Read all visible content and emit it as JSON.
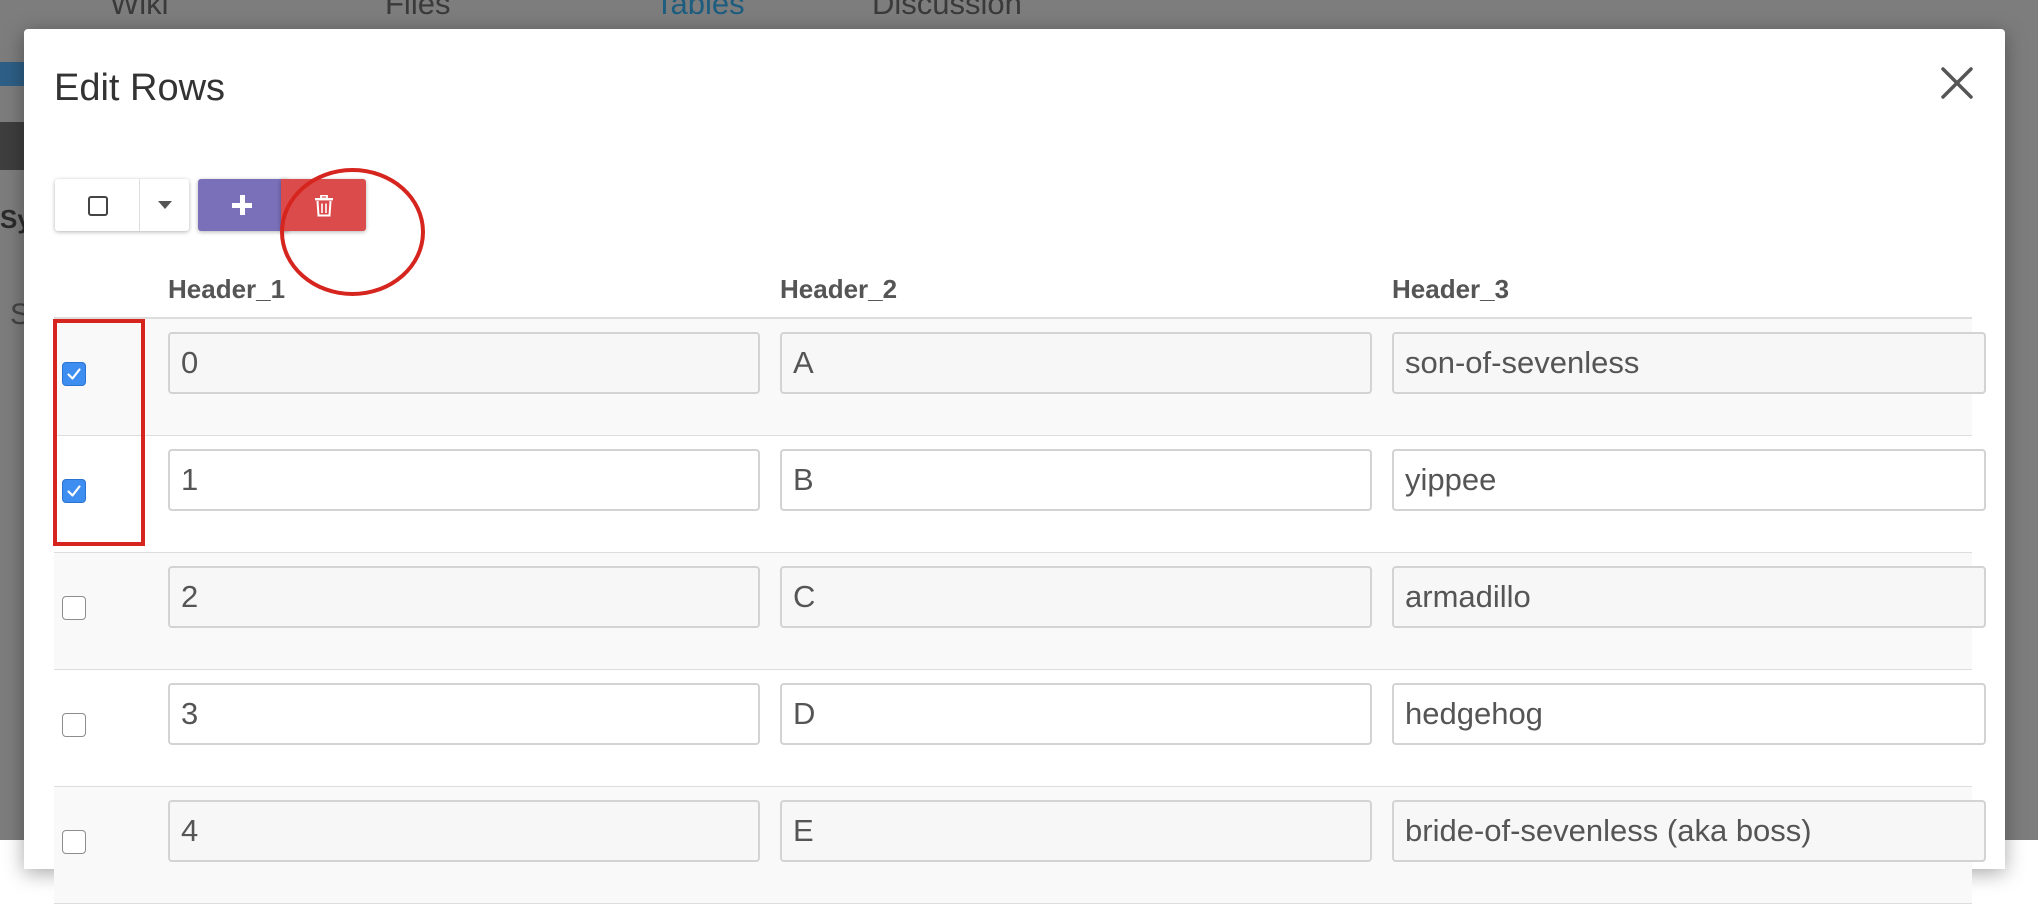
{
  "background": {
    "tabs": [
      "Wiki",
      "Files",
      "Tables",
      "Discussion"
    ],
    "fragments": [
      "Sy",
      "S"
    ]
  },
  "modal": {
    "title": "Edit Rows",
    "close_icon": "close-icon"
  },
  "toolbar": {
    "select_all_icon": "checkbox-square-icon",
    "dropdown_icon": "caret-down-icon",
    "add_icon": "plus-icon",
    "delete_icon": "trash-icon",
    "add_color": "#7a6fb9",
    "delete_color": "#dc4b4b"
  },
  "table": {
    "headers": [
      "Header_1",
      "Header_2",
      "Header_3"
    ],
    "rows": [
      {
        "checked": true,
        "cells": [
          "0",
          "A",
          "son-of-sevenless"
        ]
      },
      {
        "checked": true,
        "cells": [
          "1",
          "B",
          "yippee"
        ]
      },
      {
        "checked": false,
        "cells": [
          "2",
          "C",
          "armadillo"
        ]
      },
      {
        "checked": false,
        "cells": [
          "3",
          "D",
          "hedgehog"
        ]
      },
      {
        "checked": false,
        "cells": [
          "4",
          "E",
          "bride-of-sevenless (aka boss)"
        ]
      }
    ]
  },
  "annotation": {
    "color": "#d6251f"
  }
}
